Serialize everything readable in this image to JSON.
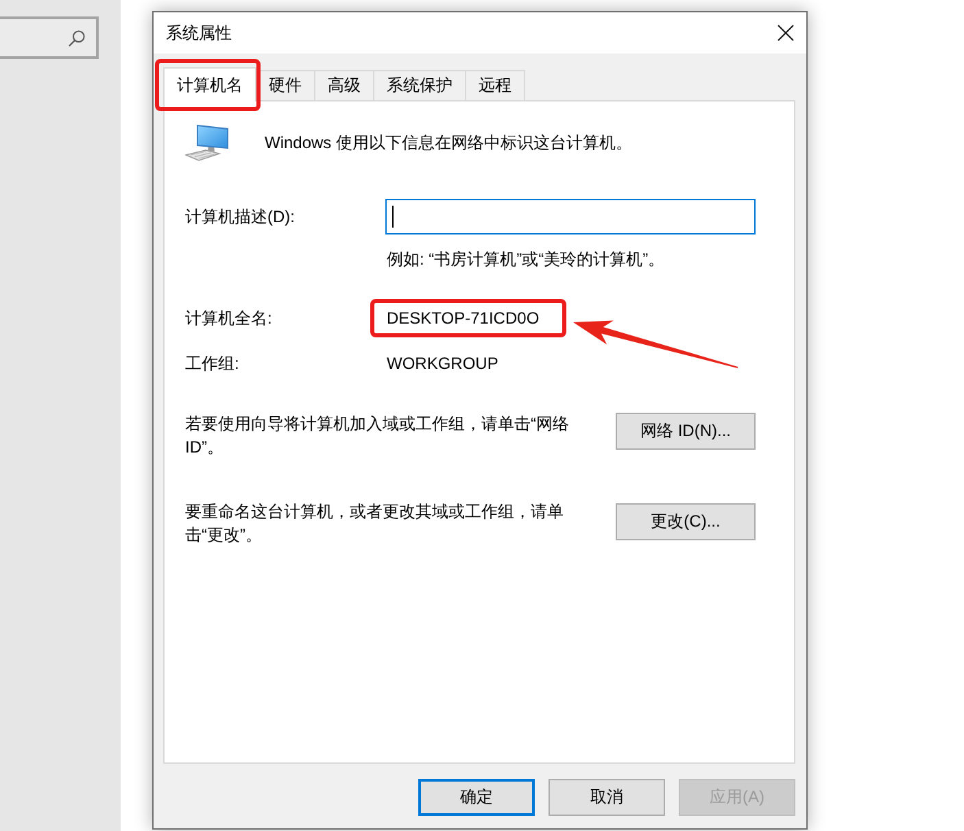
{
  "window": {
    "title": "系统属性"
  },
  "tabs": [
    {
      "label": "计算机名",
      "selected": true,
      "highlighted": true
    },
    {
      "label": "硬件",
      "selected": false,
      "highlighted": false
    },
    {
      "label": "高级",
      "selected": false,
      "highlighted": false
    },
    {
      "label": "系统保护",
      "selected": false,
      "highlighted": false
    },
    {
      "label": "远程",
      "selected": false,
      "highlighted": false
    }
  ],
  "intro": "Windows 使用以下信息在网络中标识这台计算机。",
  "description": {
    "label": "计算机描述(D):",
    "focused": true,
    "hint": "例如: “书房计算机”或“美玲的计算机”。"
  },
  "info_rows": [
    {
      "label": "计算机全名:",
      "value": "DESKTOP-71ICD0O",
      "highlighted": true,
      "arrow": true
    },
    {
      "label": "工作组:",
      "value": "WORKGROUP",
      "highlighted": false,
      "arrow": false
    }
  ],
  "actions": [
    {
      "text": "若要使用向导将计算机加入域或工作组，请单击“网络 ID”。",
      "button": "网络 ID(N)..."
    },
    {
      "text": "要重命名这台计算机，或者更改其域或工作组，请单击“更改”。",
      "button": "更改(C)..."
    }
  ],
  "buttons": [
    {
      "label": "确定",
      "default": true,
      "disabled": false
    },
    {
      "label": "取消",
      "default": false,
      "disabled": false
    },
    {
      "label": "应用(A)",
      "default": false,
      "disabled": true
    }
  ]
}
